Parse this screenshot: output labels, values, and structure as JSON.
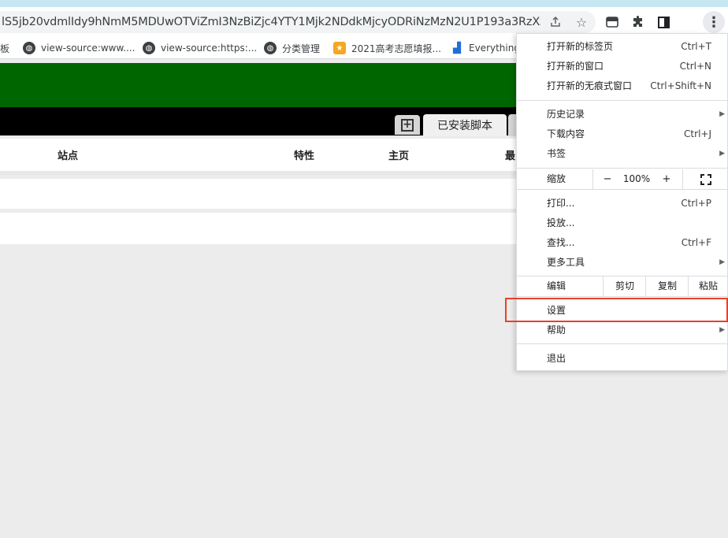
{
  "browser": {
    "url": "lS5jb20vdmlIdy9hNmM5MDUwOTViZmI3NzBiZjc4YTY1Mjk2NDdkMjcyODRiNzMzN2U1P193a3RzXz0..."
  },
  "bookmarks": [
    {
      "label": "板",
      "icon": "none"
    },
    {
      "label": "view-source:www....",
      "icon": "globe-icon"
    },
    {
      "label": "view-source:https:...",
      "icon": "globe-icon"
    },
    {
      "label": "分类管理",
      "icon": "globe-icon"
    },
    {
      "label": "2021高考志愿填报...",
      "icon": "app-icon"
    },
    {
      "label": "Everything",
      "icon": "bars-icon"
    }
  ],
  "page": {
    "installed_tab": "已安装脚本",
    "columns": [
      "站点",
      "特性",
      "主页",
      "最"
    ]
  },
  "menu": {
    "items": [
      {
        "label": "打开新的标签页",
        "shortcut": "Ctrl+T"
      },
      {
        "label": "打开新的窗口",
        "shortcut": "Ctrl+N"
      },
      {
        "label": "打开新的无痕式窗口",
        "shortcut": "Ctrl+Shift+N"
      },
      {
        "label": "历史记录",
        "shortcut": ""
      },
      {
        "label": "下载内容",
        "shortcut": "Ctrl+J"
      },
      {
        "label": "书签",
        "shortcut": ""
      },
      {
        "label": "打印...",
        "shortcut": "Ctrl+P"
      },
      {
        "label": "投放...",
        "shortcut": ""
      },
      {
        "label": "查找...",
        "shortcut": "Ctrl+F"
      },
      {
        "label": "更多工具",
        "shortcut": ""
      },
      {
        "label": "设置",
        "shortcut": ""
      },
      {
        "label": "帮助",
        "shortcut": ""
      },
      {
        "label": "退出",
        "shortcut": ""
      }
    ],
    "zoom": {
      "label": "缩放",
      "minus": "−",
      "value": "100%",
      "plus": "+"
    },
    "edit": {
      "label": "编辑",
      "cut": "剪切",
      "copy": "复制",
      "paste": "粘贴"
    }
  },
  "colors": {
    "highlight": "#e8402a",
    "page_header": "#006600"
  }
}
